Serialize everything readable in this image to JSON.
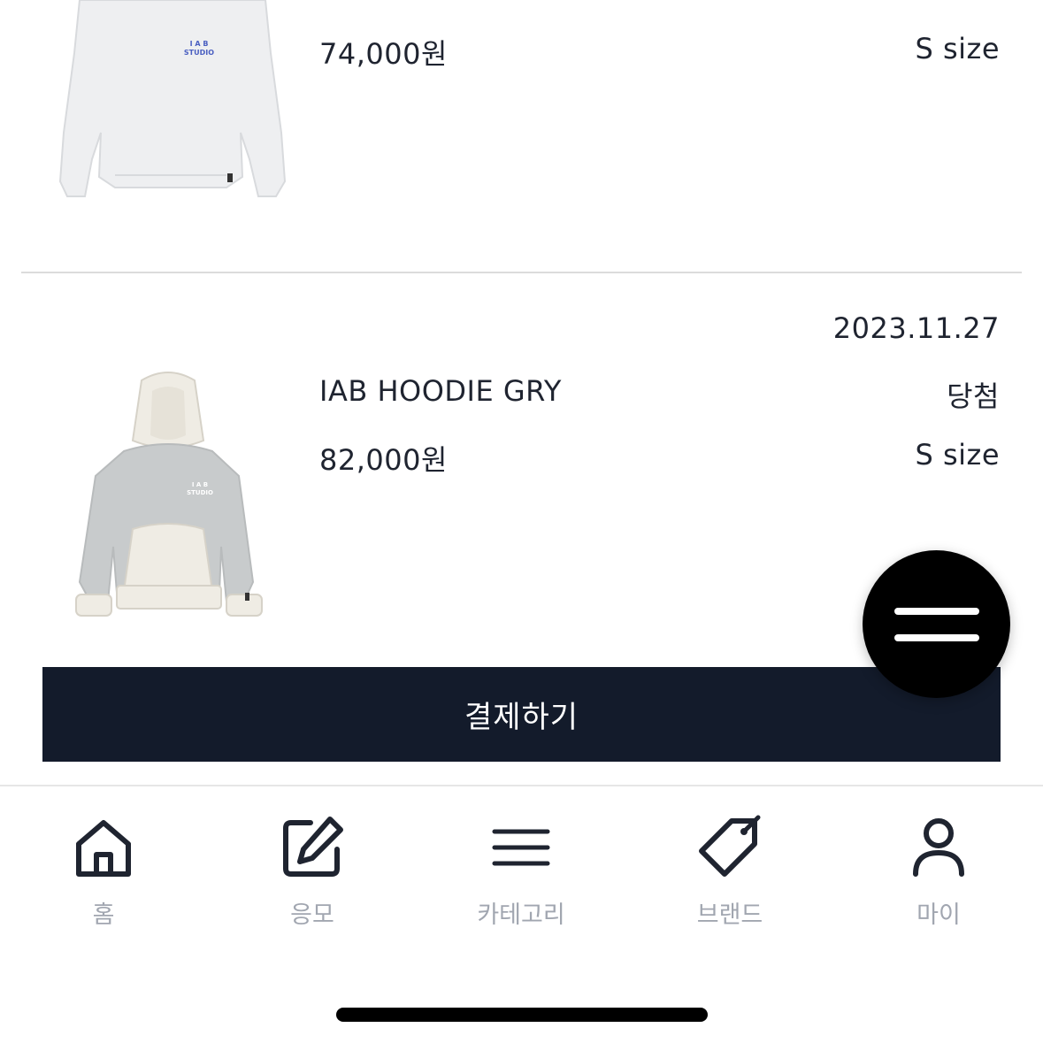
{
  "items": [
    {
      "price": "74,000원",
      "size": "S size",
      "image_icon": "gray-sweatshirt-image",
      "print_text": "I A B\nSTUDIO"
    },
    {
      "date": "2023.11.27",
      "name": "IAB HOODIE GRY",
      "status": "당첨",
      "price": "82,000원",
      "size": "S size",
      "image_icon": "gray-hoodie-image",
      "print_text": "I A B\nSTUDIO"
    }
  ],
  "pay_button": {
    "label": "결제하기"
  },
  "fab": {
    "icon": "menu-icon"
  },
  "bottom_nav": [
    {
      "label": "홈",
      "icon": "home-icon"
    },
    {
      "label": "응모",
      "icon": "edit-icon"
    },
    {
      "label": "카테고리",
      "icon": "list-icon"
    },
    {
      "label": "브랜드",
      "icon": "tag-icon"
    },
    {
      "label": "마이",
      "icon": "user-icon"
    }
  ],
  "colors": {
    "button_bg": "#131b2b",
    "nav_icon": "#1f2430",
    "nav_label": "#a1a6b0",
    "divider": "#dcdcdc"
  }
}
